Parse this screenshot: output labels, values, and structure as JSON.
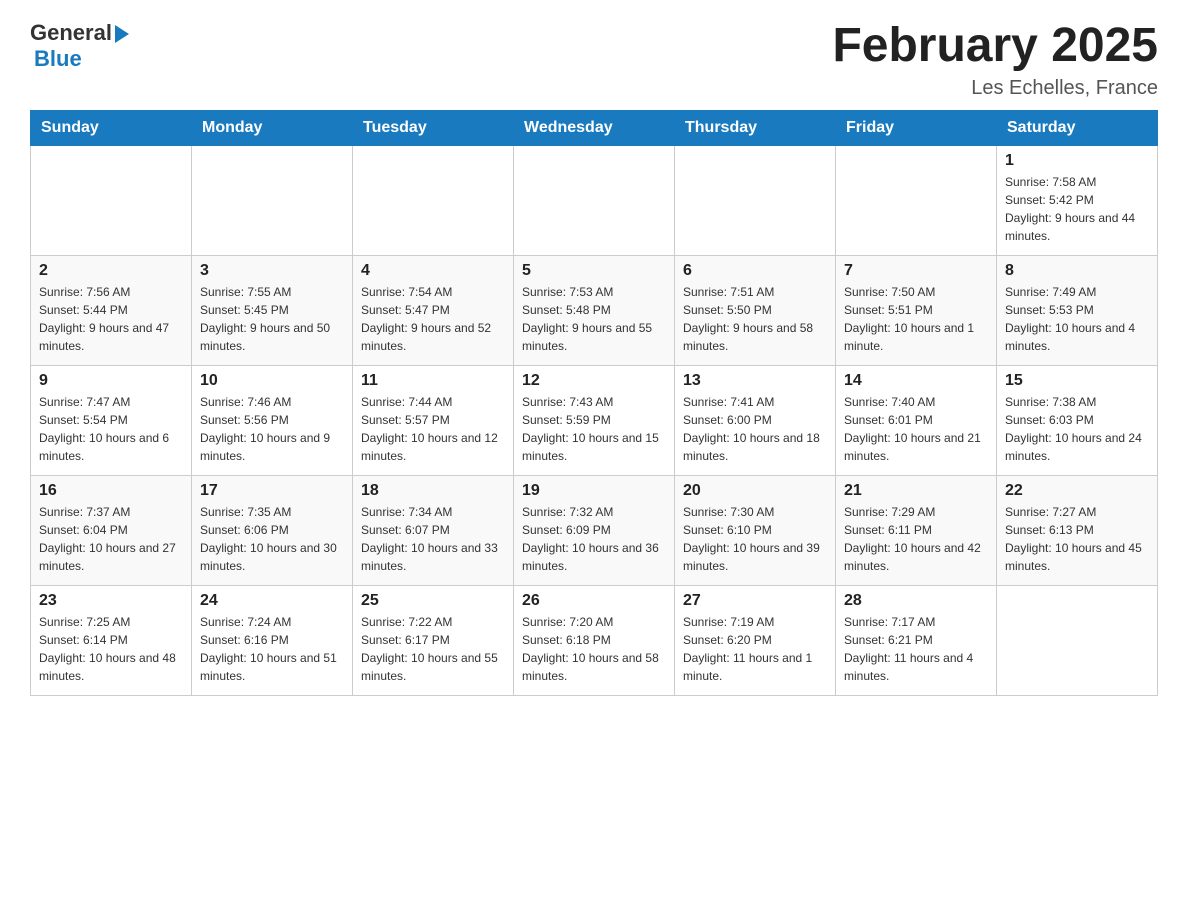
{
  "header": {
    "logo_general": "General",
    "logo_blue": "Blue",
    "month_title": "February 2025",
    "location": "Les Echelles, France"
  },
  "weekdays": [
    "Sunday",
    "Monday",
    "Tuesday",
    "Wednesday",
    "Thursday",
    "Friday",
    "Saturday"
  ],
  "weeks": [
    [
      {
        "day": "",
        "info": ""
      },
      {
        "day": "",
        "info": ""
      },
      {
        "day": "",
        "info": ""
      },
      {
        "day": "",
        "info": ""
      },
      {
        "day": "",
        "info": ""
      },
      {
        "day": "",
        "info": ""
      },
      {
        "day": "1",
        "info": "Sunrise: 7:58 AM\nSunset: 5:42 PM\nDaylight: 9 hours and 44 minutes."
      }
    ],
    [
      {
        "day": "2",
        "info": "Sunrise: 7:56 AM\nSunset: 5:44 PM\nDaylight: 9 hours and 47 minutes."
      },
      {
        "day": "3",
        "info": "Sunrise: 7:55 AM\nSunset: 5:45 PM\nDaylight: 9 hours and 50 minutes."
      },
      {
        "day": "4",
        "info": "Sunrise: 7:54 AM\nSunset: 5:47 PM\nDaylight: 9 hours and 52 minutes."
      },
      {
        "day": "5",
        "info": "Sunrise: 7:53 AM\nSunset: 5:48 PM\nDaylight: 9 hours and 55 minutes."
      },
      {
        "day": "6",
        "info": "Sunrise: 7:51 AM\nSunset: 5:50 PM\nDaylight: 9 hours and 58 minutes."
      },
      {
        "day": "7",
        "info": "Sunrise: 7:50 AM\nSunset: 5:51 PM\nDaylight: 10 hours and 1 minute."
      },
      {
        "day": "8",
        "info": "Sunrise: 7:49 AM\nSunset: 5:53 PM\nDaylight: 10 hours and 4 minutes."
      }
    ],
    [
      {
        "day": "9",
        "info": "Sunrise: 7:47 AM\nSunset: 5:54 PM\nDaylight: 10 hours and 6 minutes."
      },
      {
        "day": "10",
        "info": "Sunrise: 7:46 AM\nSunset: 5:56 PM\nDaylight: 10 hours and 9 minutes."
      },
      {
        "day": "11",
        "info": "Sunrise: 7:44 AM\nSunset: 5:57 PM\nDaylight: 10 hours and 12 minutes."
      },
      {
        "day": "12",
        "info": "Sunrise: 7:43 AM\nSunset: 5:59 PM\nDaylight: 10 hours and 15 minutes."
      },
      {
        "day": "13",
        "info": "Sunrise: 7:41 AM\nSunset: 6:00 PM\nDaylight: 10 hours and 18 minutes."
      },
      {
        "day": "14",
        "info": "Sunrise: 7:40 AM\nSunset: 6:01 PM\nDaylight: 10 hours and 21 minutes."
      },
      {
        "day": "15",
        "info": "Sunrise: 7:38 AM\nSunset: 6:03 PM\nDaylight: 10 hours and 24 minutes."
      }
    ],
    [
      {
        "day": "16",
        "info": "Sunrise: 7:37 AM\nSunset: 6:04 PM\nDaylight: 10 hours and 27 minutes."
      },
      {
        "day": "17",
        "info": "Sunrise: 7:35 AM\nSunset: 6:06 PM\nDaylight: 10 hours and 30 minutes."
      },
      {
        "day": "18",
        "info": "Sunrise: 7:34 AM\nSunset: 6:07 PM\nDaylight: 10 hours and 33 minutes."
      },
      {
        "day": "19",
        "info": "Sunrise: 7:32 AM\nSunset: 6:09 PM\nDaylight: 10 hours and 36 minutes."
      },
      {
        "day": "20",
        "info": "Sunrise: 7:30 AM\nSunset: 6:10 PM\nDaylight: 10 hours and 39 minutes."
      },
      {
        "day": "21",
        "info": "Sunrise: 7:29 AM\nSunset: 6:11 PM\nDaylight: 10 hours and 42 minutes."
      },
      {
        "day": "22",
        "info": "Sunrise: 7:27 AM\nSunset: 6:13 PM\nDaylight: 10 hours and 45 minutes."
      }
    ],
    [
      {
        "day": "23",
        "info": "Sunrise: 7:25 AM\nSunset: 6:14 PM\nDaylight: 10 hours and 48 minutes."
      },
      {
        "day": "24",
        "info": "Sunrise: 7:24 AM\nSunset: 6:16 PM\nDaylight: 10 hours and 51 minutes."
      },
      {
        "day": "25",
        "info": "Sunrise: 7:22 AM\nSunset: 6:17 PM\nDaylight: 10 hours and 55 minutes."
      },
      {
        "day": "26",
        "info": "Sunrise: 7:20 AM\nSunset: 6:18 PM\nDaylight: 10 hours and 58 minutes."
      },
      {
        "day": "27",
        "info": "Sunrise: 7:19 AM\nSunset: 6:20 PM\nDaylight: 11 hours and 1 minute."
      },
      {
        "day": "28",
        "info": "Sunrise: 7:17 AM\nSunset: 6:21 PM\nDaylight: 11 hours and 4 minutes."
      },
      {
        "day": "",
        "info": ""
      }
    ]
  ]
}
